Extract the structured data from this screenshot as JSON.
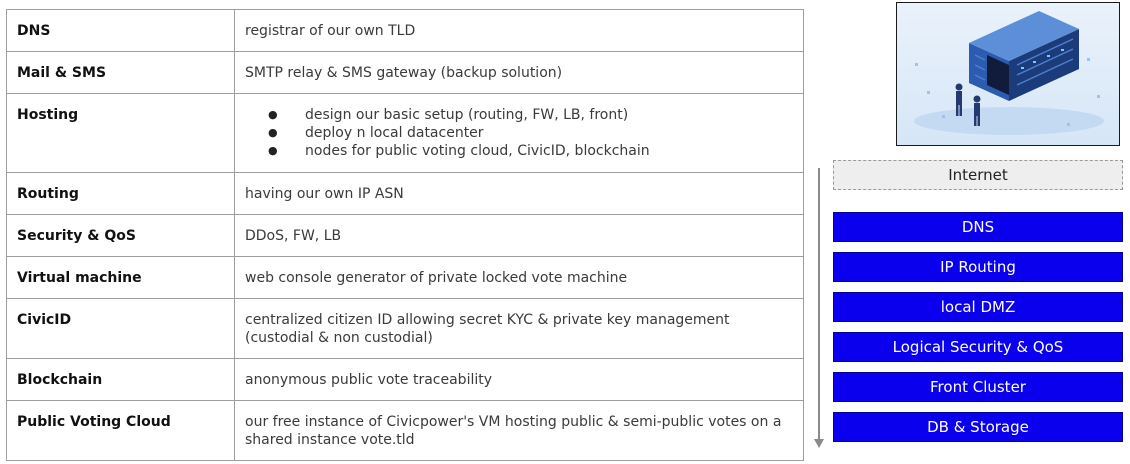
{
  "table": {
    "rows": [
      {
        "key": "DNS",
        "value": "registrar of our own TLD"
      },
      {
        "key": "Mail & SMS",
        "value": "SMTP relay & SMS gateway (backup solution)"
      },
      {
        "key": "Hosting",
        "bullets": [
          "design our basic setup (routing, FW, LB, front)",
          "deploy n local datacenter",
          "nodes for public voting cloud, CivicID, blockchain"
        ]
      },
      {
        "key": "Routing",
        "value": "having our own IP ASN"
      },
      {
        "key": "Security & QoS",
        "value": "DDoS, FW, LB"
      },
      {
        "key": "Virtual machine",
        "value": "web console generator of private locked vote machine"
      },
      {
        "key": "CivicID",
        "value": "centralized citizen ID allowing secret KYC & private key management (custodial & non custodial)"
      },
      {
        "key": "Blockchain",
        "value": "anonymous public vote traceability"
      },
      {
        "key": "Public Voting Cloud",
        "value": "our free instance of Civicpower's VM hosting public & semi-public votes on a shared instance vote.tld"
      }
    ]
  },
  "stack": {
    "internet": "Internet",
    "layers": [
      "DNS",
      "IP Routing",
      "local DMZ",
      "Logical Security & QoS",
      "Front Cluster",
      "DB & Storage"
    ]
  },
  "colors": {
    "layer_fill": "#0a00ee",
    "internet_fill": "#eeeeee",
    "border": "#9e9e9e"
  },
  "illustration": {
    "icon": "datacenter-servers-illustration"
  }
}
